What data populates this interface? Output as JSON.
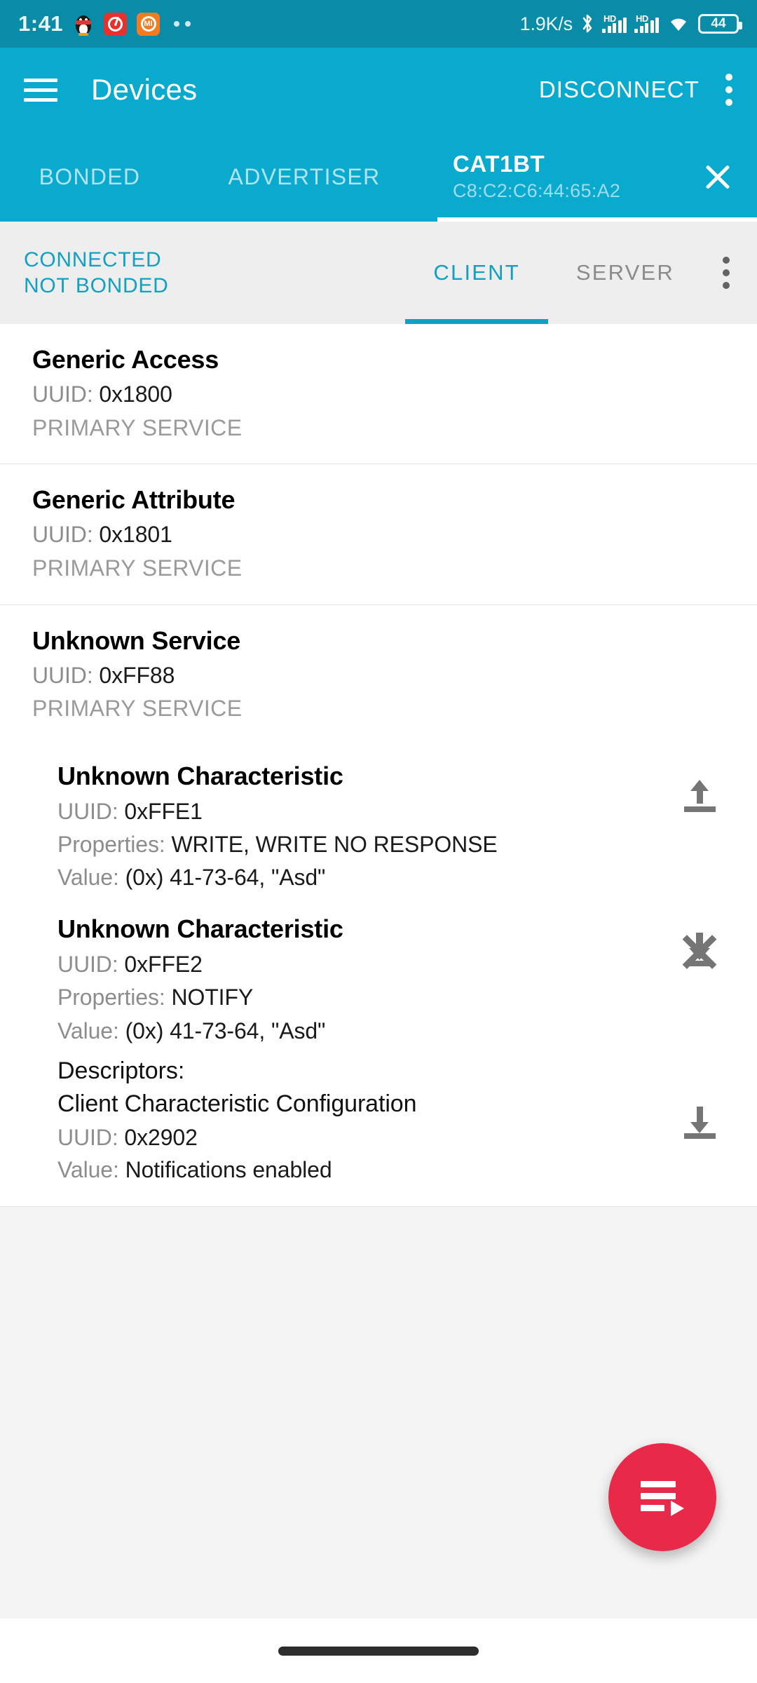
{
  "status_bar": {
    "clock": "1:41",
    "network_speed": "1.9K/s",
    "battery_level": "44",
    "icons": [
      "qq-icon",
      "music-icon",
      "mi-icon",
      "more-dots-icon",
      "bluetooth-icon",
      "signal-hd-icon",
      "signal-hd-icon",
      "wifi-icon",
      "battery-icon"
    ]
  },
  "app_bar": {
    "menu_icon": "hamburger-icon",
    "title": "Devices",
    "disconnect_label": "DISCONNECT",
    "overflow_icon": "kebab-menu-icon"
  },
  "device_tabs": {
    "items": [
      {
        "label": "BONDED",
        "active": false
      },
      {
        "label": "ADVERTISER",
        "active": false
      }
    ],
    "active_tab": {
      "name": "CAT1BT",
      "mac": "C8:C2:C6:44:65:A2",
      "close_icon": "close-icon"
    }
  },
  "connection": {
    "state": "CONNECTED",
    "bond_state": "NOT BONDED",
    "tabs": [
      {
        "label": "CLIENT",
        "active": true
      },
      {
        "label": "SERVER",
        "active": false
      }
    ],
    "overflow_icon": "kebab-menu-icon"
  },
  "labels": {
    "uuid": "UUID:",
    "properties": "Properties:",
    "value": "Value:",
    "descriptors": "Descriptors:"
  },
  "services": [
    {
      "name": "Generic Access",
      "uuid": "0x1800",
      "type": "PRIMARY SERVICE",
      "characteristics": []
    },
    {
      "name": "Generic Attribute",
      "uuid": "0x1801",
      "type": "PRIMARY SERVICE",
      "characteristics": []
    },
    {
      "name": "Unknown Service",
      "uuid": "0xFF88",
      "type": "PRIMARY SERVICE",
      "characteristics": [
        {
          "name": "Unknown Characteristic",
          "uuid": "0xFFE1",
          "properties": "WRITE, WRITE NO RESPONSE",
          "value": "(0x) 41-73-64, \"Asd\"",
          "action_icon": "upload-icon"
        },
        {
          "name": "Unknown Characteristic",
          "uuid": "0xFFE2",
          "properties": "NOTIFY",
          "value": "(0x) 41-73-64, \"Asd\"",
          "action_icon": "notifications-off-icon",
          "descriptors": [
            {
              "name": "Client Characteristic Configuration",
              "uuid": "0x2902",
              "value": "Notifications enabled",
              "action_icon": "download-icon"
            }
          ]
        }
      ]
    }
  ],
  "fab": {
    "icon": "playlist-play-icon"
  },
  "colors": {
    "status_bar_bg": "#0a8ba8",
    "app_bar_bg": "#09aacd",
    "accent_teal": "#11a0bf",
    "fab_red": "#e9294a",
    "content_bg": "#f4f4f4",
    "card_bg": "#ffffff",
    "muted_text": "#8d8d8d"
  }
}
